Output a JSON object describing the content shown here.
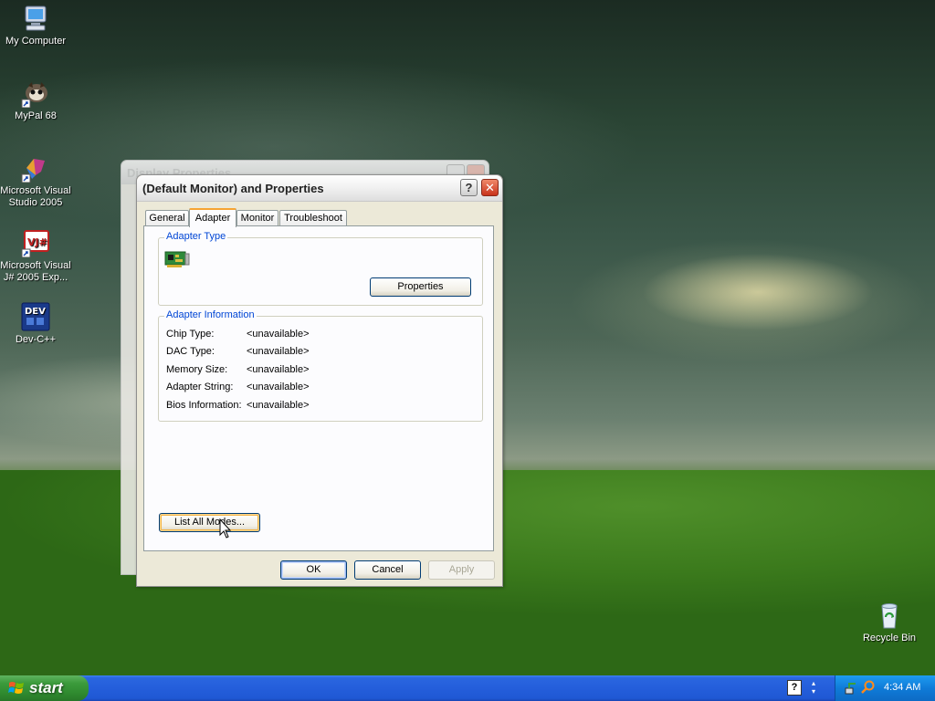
{
  "desktop": {
    "icons": [
      {
        "label": "My Computer",
        "icon": "my-computer-icon"
      },
      {
        "label": "MyPal 68",
        "icon": "mypal-icon"
      },
      {
        "label": "Microsoft Visual Studio 2005",
        "icon": "visual-studio-icon"
      },
      {
        "label": "Microsoft Visual J# 2005 Exp...",
        "icon": "visual-jsharp-icon"
      },
      {
        "label": "Dev-C++",
        "icon": "dev-cpp-icon"
      },
      {
        "label": "Recycle Bin",
        "icon": "recycle-bin-icon"
      }
    ]
  },
  "back_window": {
    "title": "Display Properties"
  },
  "dialog": {
    "title": "(Default Monitor) and  Properties",
    "help_glyph": "?",
    "close_glyph": "✕",
    "tabs": [
      {
        "label": "General",
        "active": false
      },
      {
        "label": "Adapter",
        "active": true
      },
      {
        "label": "Monitor",
        "active": false
      },
      {
        "label": "Troubleshoot",
        "active": false
      }
    ],
    "adapter_type": {
      "label": "Adapter Type",
      "icon": "adapter-card-icon",
      "properties_button": "Properties"
    },
    "adapter_info": {
      "label": "Adapter Information",
      "rows": [
        {
          "key": "Chip Type:",
          "value": "<unavailable>"
        },
        {
          "key": "DAC Type:",
          "value": "<unavailable>"
        },
        {
          "key": "Memory Size:",
          "value": "<unavailable>"
        },
        {
          "key": "Adapter String:",
          "value": "<unavailable>"
        },
        {
          "key": "Bios Information:",
          "value": "<unavailable>"
        }
      ]
    },
    "list_modes_button": "List All Modes...",
    "ok_button": "OK",
    "cancel_button": "Cancel",
    "apply_button": "Apply"
  },
  "taskbar": {
    "start_label": "start",
    "clock": "4:34 AM"
  },
  "colors": {
    "taskbar_blue": "#245edb",
    "start_green": "#3c9b3c",
    "group_label_blue": "#0046d5",
    "active_tab_accent": "#f6a434"
  }
}
